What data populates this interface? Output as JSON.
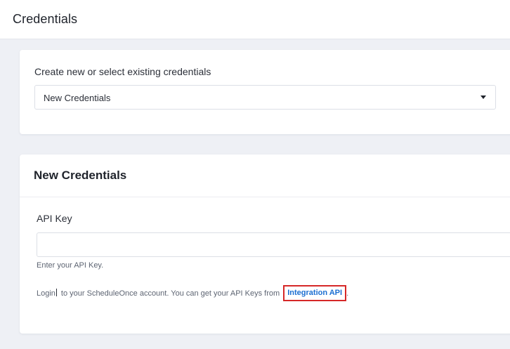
{
  "header": {
    "title": "Credentials"
  },
  "credentials_select": {
    "label": "Create new or select existing credentials",
    "selected_value": "New Credentials"
  },
  "new_credentials": {
    "title": "New Credentials",
    "api_key": {
      "label": "API Key",
      "value": "",
      "hint": "Enter your API Key."
    },
    "help": {
      "prefix_before_cursor": "Login",
      "text_after_cursor": "to your ScheduleOnce account. You can get your API Keys from",
      "link_label": "Integration API",
      "suffix": "."
    }
  },
  "colors": {
    "link": "#1c6fd1",
    "highlight_border": "#d62828",
    "page_background": "#eef0f5"
  },
  "icons": {
    "select_caret": "caret-down-icon",
    "text_cursor": "i-beam-cursor-icon"
  }
}
